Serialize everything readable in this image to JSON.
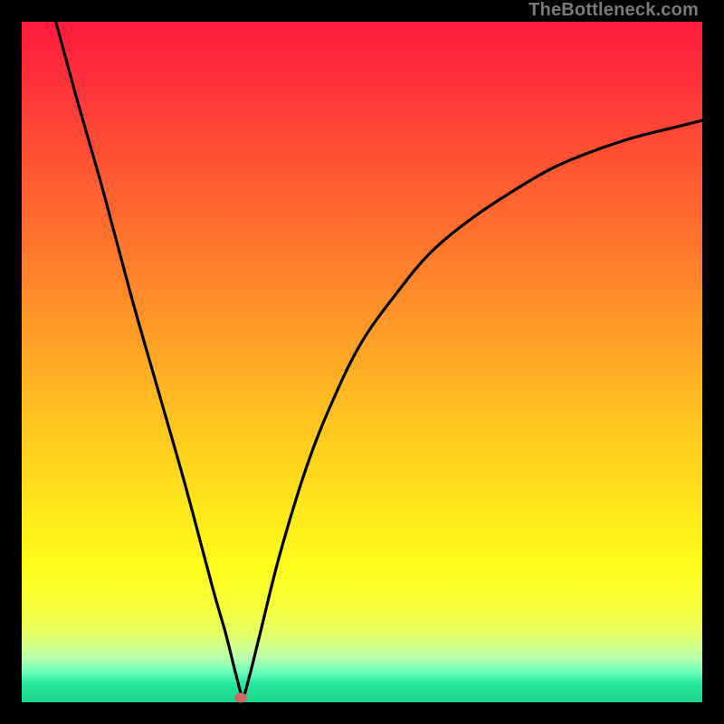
{
  "watermark": "TheBottleneck.com",
  "chart_data": {
    "type": "line",
    "title": "",
    "xlabel": "",
    "ylabel": "",
    "xlim": [
      0,
      100
    ],
    "ylim": [
      0,
      100
    ],
    "grid": false,
    "legend": false,
    "series": [
      {
        "name": "bottleneck-curve",
        "x": [
          5,
          8,
          12,
          16,
          20,
          24,
          28,
          30,
          31.5,
          32.5,
          33.5,
          35,
          38,
          42,
          46,
          50,
          55,
          60,
          66,
          72,
          78,
          84,
          90,
          96,
          100
        ],
        "y": [
          100,
          89,
          75,
          60,
          46,
          32,
          17,
          10,
          4,
          1,
          4,
          10,
          22,
          35,
          45,
          53,
          60,
          66,
          71,
          75,
          78.5,
          81,
          83,
          84.5,
          85.5
        ]
      }
    ],
    "marker": {
      "x": 32.2,
      "y": 0.7,
      "color": "#cc6a63"
    },
    "background_gradient": {
      "top": "#ff1a3c",
      "mid": "#ffd21e",
      "bottom": "#1cd68a"
    }
  }
}
